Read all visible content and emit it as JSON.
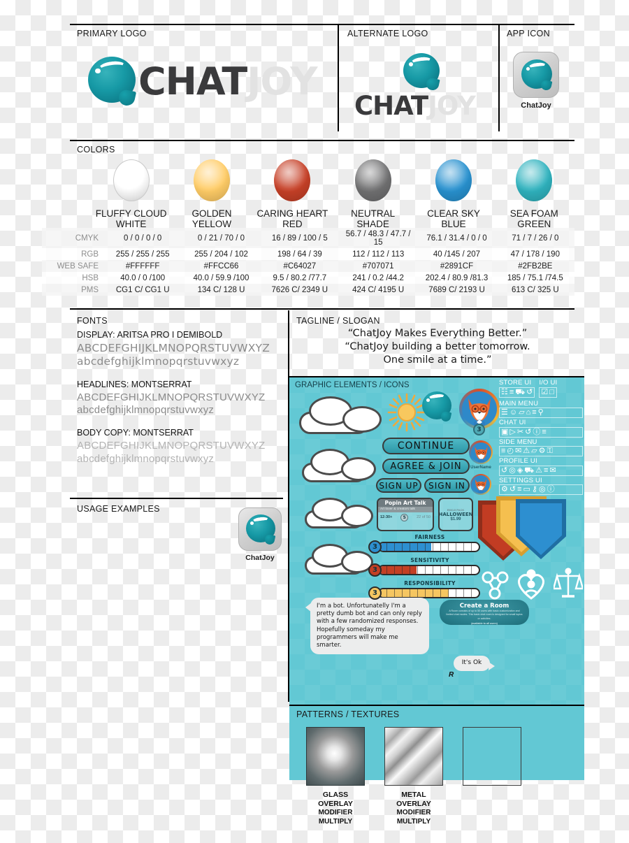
{
  "sections": {
    "primary_logo": "PRIMARY LOGO",
    "alternate_logo": "ALTERNATE LOGO",
    "app_icon": "APP ICON",
    "colors": "COLORS",
    "fonts": "FONTS",
    "tagline": "TAGLINE / SLOGAN",
    "graphic_elements": "GRAPHIC ELEMENTS / ICONS",
    "usage_examples": "USAGE EXAMPLES",
    "patterns": "PATTERNS / TEXTURES"
  },
  "brand": {
    "word_chat": "CHAT",
    "word_joy": "JOY",
    "app_icon_label": "ChatJoy",
    "usage_icon_label": "ChatJoy"
  },
  "tagline_lines": [
    "“ChatJoy Makes Everything Better.”",
    "“ChatJoy  building a better tomorrow.",
    "One smile at a time.”"
  ],
  "colors_table": {
    "row_labels": [
      "CMYK",
      "RGB",
      "WEB SAFE",
      "HSB",
      "PMS"
    ],
    "swatches": [
      {
        "name_line1": "FLUFFY CLOUD",
        "name_line2": "WHITE",
        "hex": "#FFFFFF",
        "cmyk": "0 / 0 / 0 / 0",
        "rgb": "255 / 255 / 255",
        "web_safe": "#FFFFFF",
        "hsb": "40.0 / 0 /100",
        "pms": "CG1 C/ CG1 U"
      },
      {
        "name_line1": "GOLDEN",
        "name_line2": "YELLOW",
        "hex": "#FFCC66",
        "cmyk": "0 / 21 / 70 / 0",
        "rgb": "255 / 204 / 102",
        "web_safe": "#FFCC66",
        "hsb": "40.0 / 59.9 /100",
        "pms": "134 C/ 128 U"
      },
      {
        "name_line1": "CARING HEART",
        "name_line2": "RED",
        "hex": "#C64027",
        "cmyk": "16 / 89 / 100 / 5",
        "rgb": "198 / 64 / 39",
        "web_safe": "#C64027",
        "hsb": "9.5 / 80.2 /77.7",
        "pms": "7626 C/ 2349 U"
      },
      {
        "name_line1": "NEUTRAL",
        "name_line2": "SHADE",
        "hex": "#707071",
        "cmyk": "56.7 / 48.3 / 47.7 / 15",
        "rgb": "112 / 112 / 113",
        "web_safe": "#707071",
        "hsb": "241 / 0.2 /44.2",
        "pms": "424 C/ 4195 U"
      },
      {
        "name_line1": "CLEAR SKY",
        "name_line2": "BLUE",
        "hex": "#2891CF",
        "cmyk": "76.1 / 31.4 / 0 / 0",
        "rgb": "40 /145 / 207",
        "web_safe": "#2891CF",
        "hsb": "202.4 / 80.9 /81.3",
        "pms": "7689 C/ 2193 U"
      },
      {
        "name_line1": "SEA FOAM",
        "name_line2": "GREEN",
        "hex": "#2FB2BE",
        "cmyk": "71 / 7 / 26 / 0",
        "rgb": "47 / 178 / 190",
        "web_safe": "#2FB2BE",
        "hsb": "185 / 75.1 /74.5",
        "pms": "613 C/ 325 U"
      }
    ]
  },
  "fonts": [
    {
      "title": "DISPLAY: ARITSA PRO I DEMIBOLD",
      "upper": "ABCDEFGHIJKLMNOPQRSTUVWXYZ",
      "lower": "abcdefghijklmnopqrstuvwxyz"
    },
    {
      "title": "HEADLINES: MONTSERRAT",
      "upper": "ABCDEFGHIJKLMNOPQRSTUVWXYZ",
      "lower": "abcdefghijklmnopqrstuvwxyz"
    },
    {
      "title": "BODY COPY: MONTSERRAT",
      "upper": "ABCDEFGHIJKLMNOPQRSTUVWXYZ",
      "lower": "abcdefghijklmnopqrstuvwxyz"
    }
  ],
  "graphic": {
    "buttons": {
      "continue": "CONTINUE",
      "agree_join": "AGREE & JOIN",
      "sign_up": "SIGN UP",
      "sign_in": "SIGN IN"
    },
    "ui_groups": [
      {
        "label": "STORE UI",
        "icons": [
          "store-icon",
          "sliders-icon",
          "cart-icon",
          "refresh-icon"
        ]
      },
      {
        "label": "I/O UI",
        "icons": [
          "checkbox-checked-icon",
          "checkbox-empty-icon"
        ]
      },
      {
        "label": "MAIN MENU",
        "icons": [
          "feed-icon",
          "contacts-icon",
          "folder-icon",
          "home-icon",
          "list-icon",
          "search-icon"
        ]
      },
      {
        "label": "CHAT UI",
        "icons": [
          "camera-icon",
          "video-icon",
          "attach-icon",
          "refresh-icon",
          "info-icon",
          "sliders-icon"
        ]
      },
      {
        "label": "SIDE MENU",
        "icons": [
          "menu-icon",
          "clock-icon",
          "mail-icon",
          "alert-icon",
          "folder-icon",
          "gear-icon",
          "lock-icon"
        ]
      },
      {
        "label": "PROFILE UI",
        "icons": [
          "refresh-icon",
          "pin-icon",
          "drop-icon",
          "cart-icon",
          "alert-icon",
          "list-icon",
          "mail-icon"
        ]
      },
      {
        "label": "SETTINGS UI",
        "icons": [
          "gear-icon",
          "refresh-icon",
          "list-icon",
          "card-icon",
          "key-icon",
          "pin-icon",
          "info-icon"
        ]
      }
    ],
    "avatar": {
      "badge_level": "3",
      "username": "UserName"
    },
    "cards": {
      "popin_title": "Popin Art Talk",
      "popin_sub": "Art lover & creators talk",
      "popin_age": "12-30+",
      "popin_level": "5",
      "popin_count": "22 of 50",
      "halloween_kicker": "EMOJI PACK",
      "halloween_title": "HALLOWEEN",
      "halloween_price": "$1.99"
    },
    "meters": [
      {
        "label": "FAIRNESS",
        "level": "3",
        "percent": 52,
        "color": "#2d8fd0"
      },
      {
        "label": "SENSITIVITY",
        "level": "3",
        "percent": 37,
        "color": "#c33f24"
      },
      {
        "label": "RESPONSIBILITY",
        "level": "3",
        "percent": 70,
        "color": "#f5c661"
      }
    ],
    "shields": [
      "#c23c23",
      "#f5bf4f",
      "#2d8fd0"
    ],
    "value_icons": [
      "network-icon",
      "heart-person-icon",
      "scales-icon"
    ],
    "bot_message": "I'm a bot. Unfortunatelly I'm a pretty dumb bot and can only reply with a few randomized responses. Hopefully someday my programmers will make me smarter.",
    "user_message": "It's Ok",
    "user_initial": "R",
    "room": {
      "title": "Create a Room",
      "body": "A Room consists of up to 50 users with basic customization and limited chat modes. This basic chat room is designed for small topics or activities.",
      "note": "(available to all users)"
    }
  },
  "patterns": [
    {
      "name": "GLASS OVERLAY",
      "modifier": "MODIFIER",
      "blend": "MULTIPLY",
      "style": "glass"
    },
    {
      "name": "METAL OVERLAY",
      "modifier": "MODIFIER",
      "blend": "MULTIPLY",
      "style": "metal"
    },
    {
      "name": "",
      "modifier": "",
      "blend": "",
      "style": "empty"
    }
  ],
  "palette": {
    "teal_panel": "#62c8d4",
    "bubble_teal": "#179aa6",
    "wordmark_dark": "#3a3a3c",
    "wordmark_light": "#e2e2e2"
  }
}
